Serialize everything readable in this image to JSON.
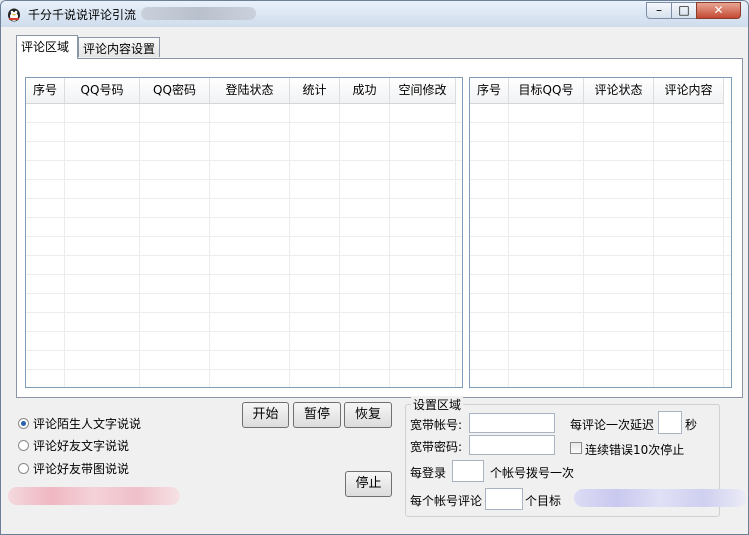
{
  "window": {
    "title": "千分千说说评论引流",
    "minimize": "–",
    "maximize": "□",
    "close": "✕"
  },
  "tabs": [
    {
      "label": "评论区域",
      "active": true
    },
    {
      "label": "评论内容设置",
      "active": false
    }
  ],
  "left_table": {
    "columns": [
      "序号",
      "QQ号码",
      "QQ密码",
      "登陆状态",
      "统计",
      "成功",
      "空间修改"
    ],
    "rows": []
  },
  "right_table": {
    "columns": [
      "序号",
      "目标QQ号",
      "评论状态",
      "评论内容"
    ],
    "rows": []
  },
  "modes": [
    {
      "label": "评论陌生人文字说说",
      "selected": true
    },
    {
      "label": "评论好友文字说说",
      "selected": false
    },
    {
      "label": "评论好友带图说说",
      "selected": false
    }
  ],
  "buttons": {
    "start": "开始",
    "pause": "暂停",
    "resume": "恢复",
    "stop": "停止"
  },
  "settings": {
    "title": "设置区域",
    "broadband_account_label": "宽带帐号:",
    "broadband_account_value": "",
    "broadband_password_label": "宽带密码:",
    "broadband_password_value": "",
    "comment_delay_label": "每评论一次延迟",
    "comment_delay_value": "",
    "comment_delay_unit": "秒",
    "stop_on_errors_label": "连续错误10次停止",
    "stop_on_errors_checked": false,
    "redial_prefix": "每登录",
    "redial_value": "",
    "redial_suffix": "个帐号拨号一次",
    "targets_prefix": "每个帐号评论",
    "targets_value": "",
    "targets_suffix": "个目标"
  },
  "colors": {
    "accent": "#2a5fad",
    "close_button": "#c44a32",
    "border": "#7f9db9"
  }
}
